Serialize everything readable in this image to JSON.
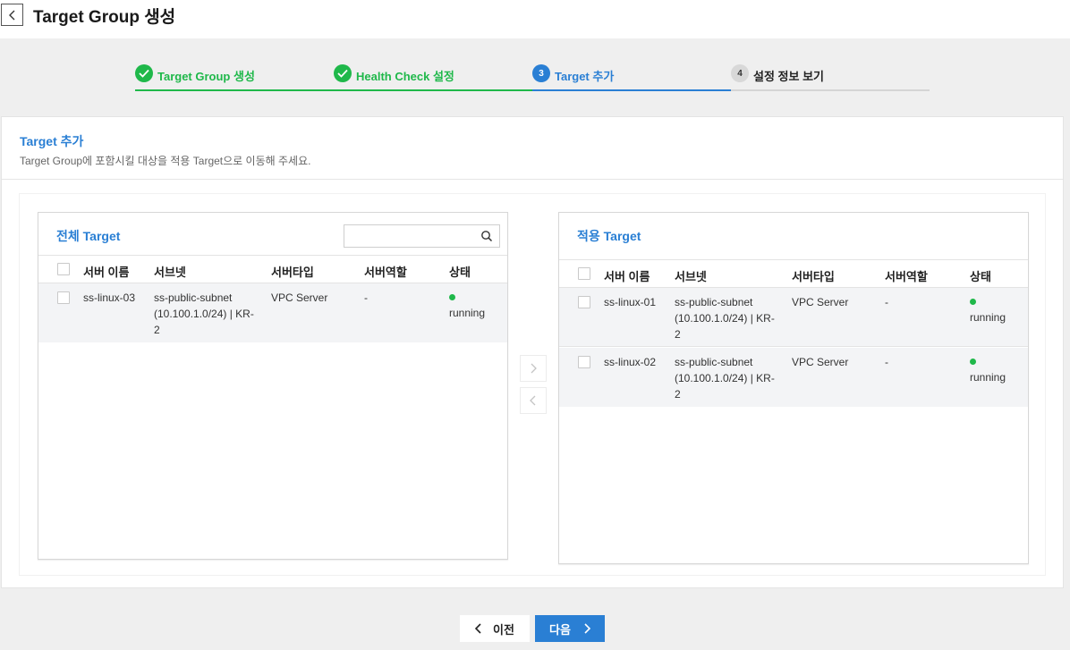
{
  "page": {
    "title": "Target Group 생성"
  },
  "steps": [
    {
      "number": "1",
      "label": "Target Group 생성",
      "state": "done"
    },
    {
      "number": "2",
      "label": "Health Check 설정",
      "state": "done"
    },
    {
      "number": "3",
      "label": "Target 추가",
      "state": "active"
    },
    {
      "number": "4",
      "label": "설정 정보 보기",
      "state": "todo"
    }
  ],
  "section": {
    "title": "Target 추가",
    "description": "Target Group에 포함시킬 대상을 적용 Target으로 이동해 주세요."
  },
  "all_targets": {
    "title": "전체 Target",
    "search_placeholder": "",
    "columns": [
      "서버 이름",
      "서브넷",
      "서버타입",
      "서버역할",
      "상태"
    ],
    "rows": [
      {
        "name": "ss-linux-03",
        "subnet": "ss-public-subnet (10.100.1.0/24) | KR-2",
        "type": "VPC Server",
        "role": "-",
        "status": "running"
      }
    ]
  },
  "applied_targets": {
    "title": "적용 Target",
    "columns": [
      "서버 이름",
      "서브넷",
      "서버타입",
      "서버역할",
      "상태"
    ],
    "rows": [
      {
        "name": "ss-linux-01",
        "subnet": "ss-public-subnet (10.100.1.0/24) | KR-2",
        "type": "VPC Server",
        "role": "-",
        "status": "running"
      },
      {
        "name": "ss-linux-02",
        "subnet": "ss-public-subnet (10.100.1.0/24) | KR-2",
        "type": "VPC Server",
        "role": "-",
        "status": "running"
      }
    ]
  },
  "buttons": {
    "prev": "이전",
    "next": "다음"
  },
  "colors": {
    "accent": "#2a7fd4",
    "success": "#1fb84a",
    "pending": "#d5d5d5"
  },
  "icons": {
    "back": "chevron-left-icon",
    "check": "check-icon",
    "search": "search-icon",
    "move_right": "chevron-right-icon",
    "move_left": "chevron-left-icon"
  }
}
